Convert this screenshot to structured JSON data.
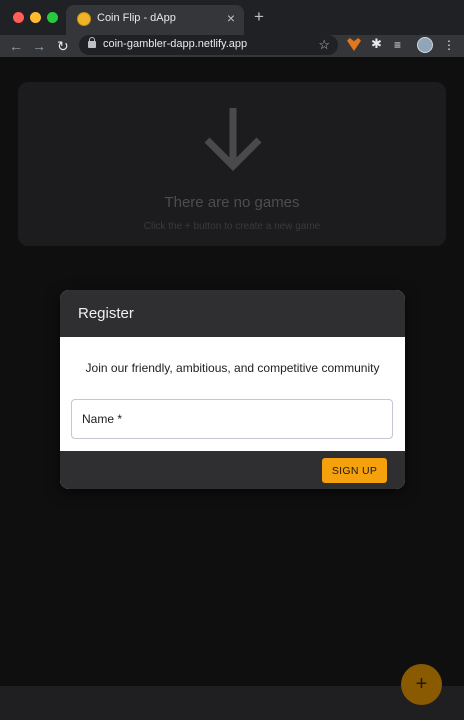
{
  "browser": {
    "tab_title": "Coin Flip - dApp",
    "tab_close": "×",
    "new_tab": "+",
    "url": "coin-gambler-dapp.netlify.app",
    "back": "←",
    "forward": "→",
    "reload": "↻",
    "star": "☆",
    "puzzle": "✱",
    "playlist": "≡",
    "menu": "⋮"
  },
  "empty_state": {
    "title": "There are no games",
    "hint": "Click the + button to create a new game"
  },
  "register_dialog": {
    "title": "Register",
    "text": "Join our friendly, ambitious, and competitive community",
    "name_label": "Name *",
    "signup_label": "SIGN UP"
  },
  "fab": {
    "label": "+"
  },
  "colors": {
    "accent": "#f5a10d",
    "page_bg": "#0f0f0f",
    "card_bg": "#1c1c1e",
    "dialog_header": "#2f2f31"
  }
}
